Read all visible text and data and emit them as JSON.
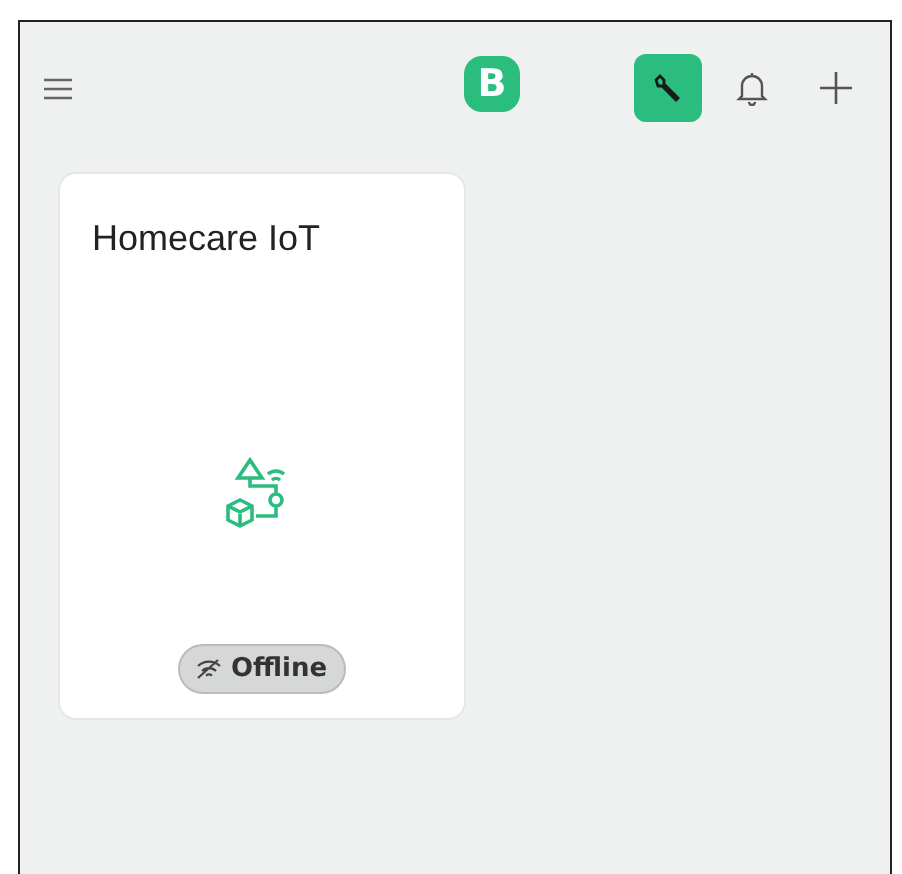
{
  "header": {
    "logo": "B",
    "tools": [
      {
        "kind": "wrench",
        "selected": true
      },
      {
        "kind": "bell",
        "selected": false
      },
      {
        "kind": "add",
        "selected": false
      }
    ]
  },
  "devices": [
    {
      "name": "Homecare IoT",
      "status": "Offline",
      "online": false
    }
  ]
}
